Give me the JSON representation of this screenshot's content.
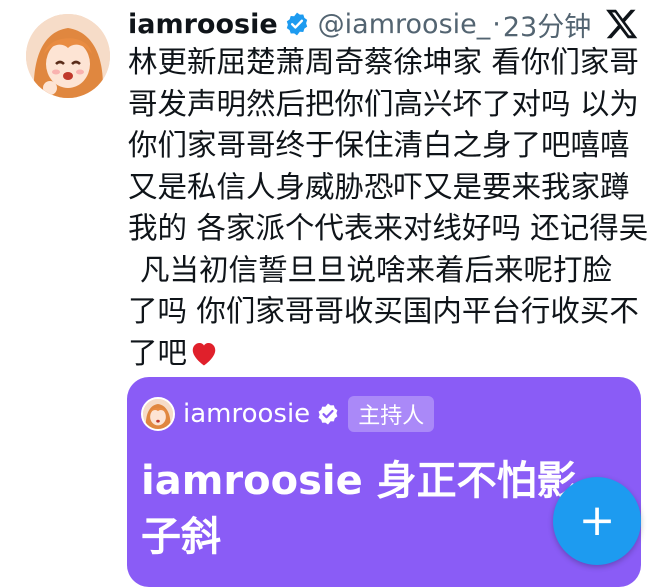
{
  "post": {
    "display_name": "iamroosie",
    "handle": "@iamroosie_",
    "separator": "·",
    "time": "23分钟",
    "text_lines": [
      "林更新屈楚萧周奇蔡徐坤家 看你们家哥",
      "哥发声明然后把你们高兴坏了对吗 以为",
      "你们家哥哥终于保住清白之身了吧嘻嘻",
      "又是私信人身威胁恐吓又是要来我家蹲",
      "我的 各家派个代表来对线好吗 还记得吴",
      "凡当初信誓旦旦说啥来着后来呢打脸",
      "了吗 你们家哥哥收买国内平台行收买不",
      "了吧"
    ],
    "icons": {
      "avatar": "anime-girl-avatar",
      "verified": "verified-badge-icon",
      "platform": "x-logo-icon",
      "heart": "red-heart-emoji"
    }
  },
  "space_card": {
    "host_name": "iamroosie",
    "host_badge": "主持人",
    "title": "iamroosie 身正不怕影子斜",
    "background_color": "#8a5cf6"
  },
  "fab": {
    "label": "+",
    "icon": "plus-icon",
    "color": "#1d9bf0"
  },
  "colors": {
    "verified": "#1d9bf0",
    "secondary_text": "#536471",
    "primary_text": "#0f1419"
  }
}
